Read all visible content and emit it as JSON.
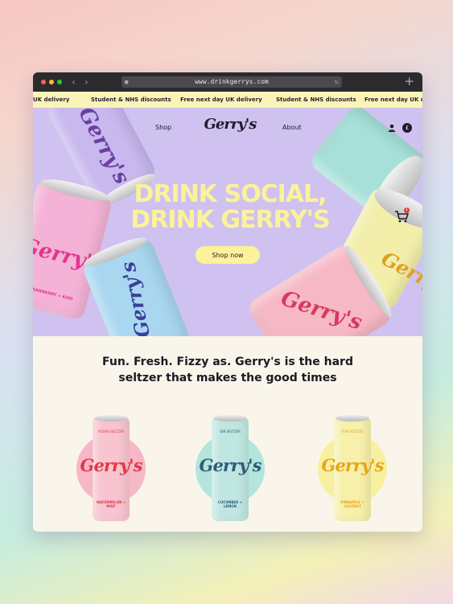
{
  "browser": {
    "url": "www.drinkgerrys.com",
    "icons": [
      "close-dot",
      "minimize-dot",
      "maximize-dot",
      "back-arrow",
      "forward-arrow",
      "lock-icon",
      "reload-icon",
      "new-tab-plus"
    ],
    "dot_colors": [
      "#ff5f57",
      "#febc2e",
      "#28c840"
    ]
  },
  "ticker": {
    "items": [
      "UK delivery",
      "Student & NHS discounts",
      "Free next day UK delivery",
      "Student & NHS discounts",
      "Free next day UK delivery"
    ]
  },
  "header": {
    "nav_shop": "Shop",
    "nav_about": "About",
    "logo": "Gerry's",
    "currency_symbol": "£",
    "cart_count": "1"
  },
  "hero": {
    "headline_line1": "DRINK SOCIAL,",
    "headline_line2": "DRINK GERRY'S",
    "cta": "Shop now",
    "accent": "#fbf29a",
    "background": "#cfc2f0",
    "cans": [
      {
        "brand": "Gerry's",
        "flavor": "STRAWBERRY + KIWI",
        "color": "#f4b3d6",
        "text_color": "#e0388f"
      },
      {
        "brand": "Gerry's",
        "flavor": "",
        "color": "#c8b8ee",
        "text_color": "#6b3fa0"
      },
      {
        "brand": "Gerry's",
        "flavor": "",
        "color": "#a9d7f0",
        "text_color": "#3b3f9a"
      },
      {
        "brand": "Gerry's",
        "flavor": "",
        "color": "#f6b8c5",
        "text_color": "#d63a5e"
      },
      {
        "brand": "Gerry's",
        "flavor": "",
        "color": "#a7e0d9",
        "text_color": "#2b6e6b"
      },
      {
        "brand": "Gerry's",
        "flavor": "",
        "color": "#f3eeaa",
        "text_color": "#e0a022"
      }
    ],
    "can_small_text": "HARD SELTZER"
  },
  "intro": {
    "tagline_line1": "Fun. Fresh. Fizzy as. Gerry's is the hard",
    "tagline_line2": "seltzer that makes the good times"
  },
  "products": [
    {
      "brand": "Gerry's",
      "flavor": "WATERMELON + MINT",
      "type": "VODKA SELTZER",
      "can_color": "#f7c4cf",
      "circle_color": "#f6b7c6",
      "text_color": "#e03a48"
    },
    {
      "brand": "Gerry's",
      "flavor": "CUCUMBER + LEMON",
      "type": "GIN SELTZER",
      "can_color": "#bfe6e0",
      "circle_color": "#b3e5dd",
      "text_color": "#2c5d7a"
    },
    {
      "brand": "Gerry's",
      "flavor": "PINEAPPLE + COCONUT",
      "type": "RUM SELTZER",
      "can_color": "#f6f0aa",
      "circle_color": "#f7f0a0",
      "text_color": "#e8a419"
    }
  ]
}
